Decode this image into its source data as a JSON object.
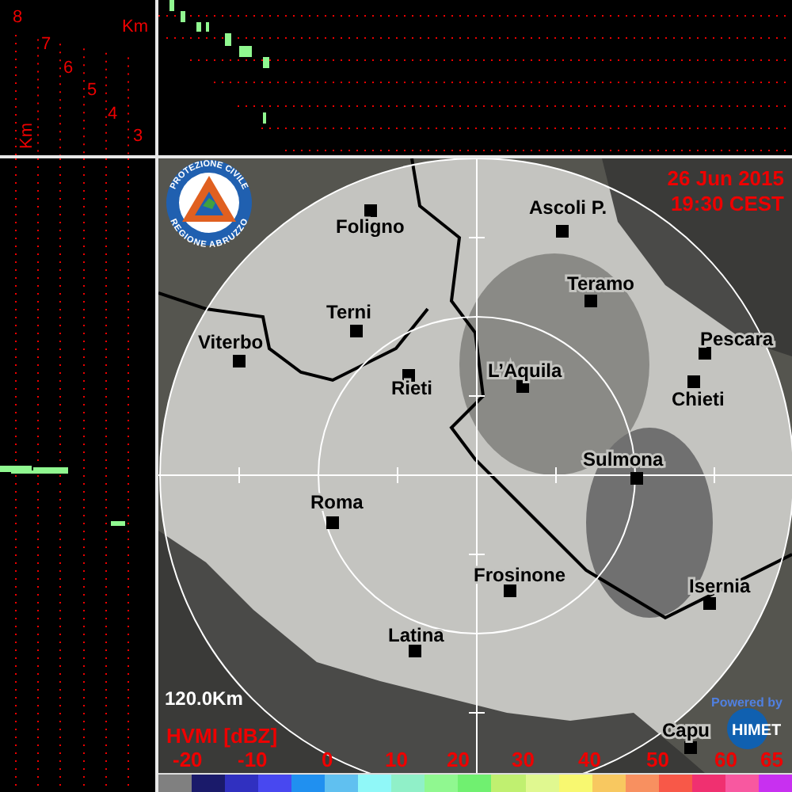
{
  "cross_section": {
    "height_labels": [
      "8",
      "7",
      "6",
      "5",
      "4",
      "3"
    ],
    "unit_top": "Km",
    "unit_side": "Km"
  },
  "map": {
    "logo_top": "PROTEZIONE CIVILE",
    "logo_bottom": "REGIONE ABRUZZO",
    "date": "26 Jun 2015",
    "time": "19:30 CEST",
    "cities": [
      {
        "name": "Foligno"
      },
      {
        "name": "Ascoli P."
      },
      {
        "name": "Teramo"
      },
      {
        "name": "Terni"
      },
      {
        "name": "Viterbo"
      },
      {
        "name": "Pescara"
      },
      {
        "name": "L’Aquila"
      },
      {
        "name": "Rieti"
      },
      {
        "name": "Chieti"
      },
      {
        "name": "Sulmona"
      },
      {
        "name": "Roma"
      },
      {
        "name": "Frosinone"
      },
      {
        "name": "Isernia"
      },
      {
        "name": "Latina"
      },
      {
        "name": "Capu"
      }
    ],
    "range": "120.0Km",
    "product": "HVMI [dBZ]",
    "scale_labels": [
      "-20",
      "-10",
      "0",
      "10",
      "20",
      "30",
      "40",
      "50",
      "60",
      "65"
    ],
    "powered_by": "Powered by",
    "brand": "HIMET"
  },
  "color_scale": [
    {
      "color": "#808080"
    },
    {
      "color": "#1a1a6a"
    },
    {
      "color": "#3030c0"
    },
    {
      "color": "#4848f0"
    },
    {
      "color": "#2090f0"
    },
    {
      "color": "#60c0f0"
    },
    {
      "color": "#90f8f8"
    },
    {
      "color": "#90f0c8"
    },
    {
      "color": "#90f890"
    },
    {
      "color": "#70f070"
    },
    {
      "color": "#c0f070"
    },
    {
      "color": "#e0f890"
    },
    {
      "color": "#f8f870"
    },
    {
      "color": "#f8c860"
    },
    {
      "color": "#f89060"
    },
    {
      "color": "#f85848"
    },
    {
      "color": "#f03070"
    },
    {
      "color": "#f858a0"
    },
    {
      "color": "#c830f0"
    }
  ]
}
